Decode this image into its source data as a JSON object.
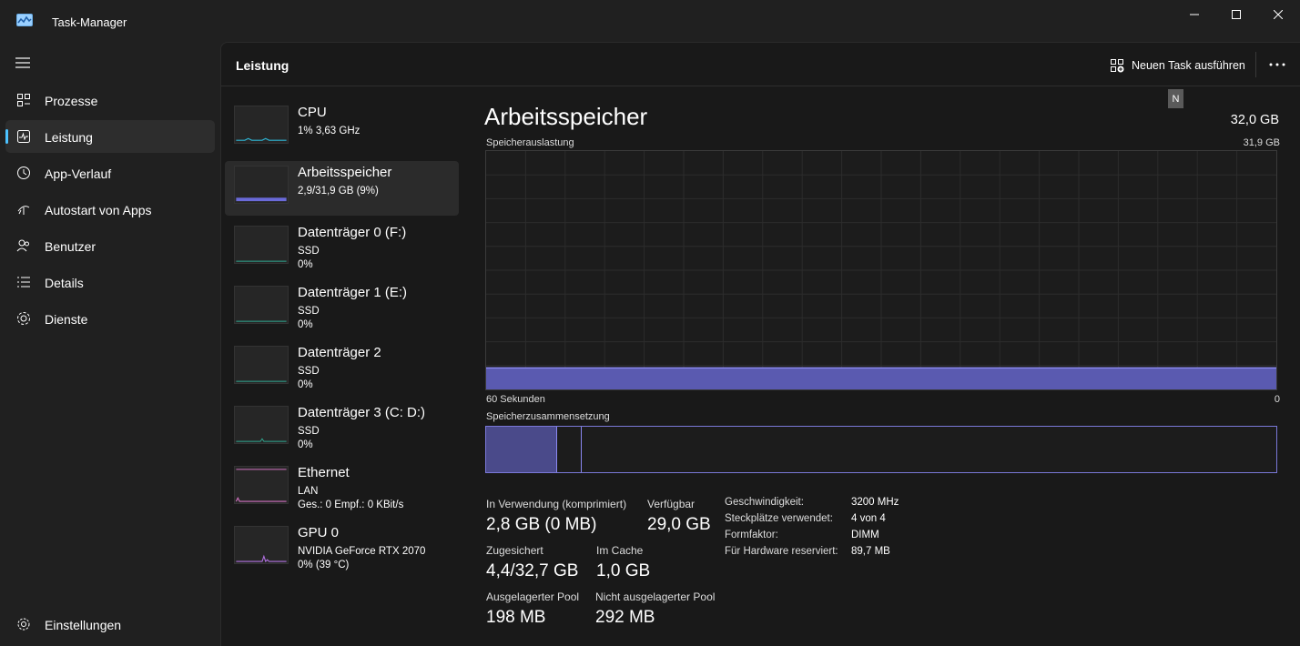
{
  "window": {
    "title": "Task-Manager"
  },
  "nav": {
    "items": [
      {
        "label": "Prozesse",
        "icon": "processes-icon"
      },
      {
        "label": "Leistung",
        "icon": "performance-icon",
        "active": true
      },
      {
        "label": "App-Verlauf",
        "icon": "app-history-icon"
      },
      {
        "label": "Autostart von Apps",
        "icon": "startup-apps-icon"
      },
      {
        "label": "Benutzer",
        "icon": "users-icon"
      },
      {
        "label": "Details",
        "icon": "details-icon"
      },
      {
        "label": "Dienste",
        "icon": "services-icon"
      }
    ],
    "settings": {
      "label": "Einstellungen",
      "icon": "settings-icon"
    }
  },
  "header": {
    "title": "Leistung",
    "new_task_label": "Neuen Task ausführen",
    "more_label": "...",
    "tooltip_letter": "N"
  },
  "resources": [
    {
      "title": "CPU",
      "line1": "1%  3,63 GHz",
      "line2": "",
      "line3": ""
    },
    {
      "title": "Arbeitsspeicher",
      "line1": "2,9/31,9 GB (9%)",
      "line2": "",
      "line3": ""
    },
    {
      "title": "Datenträger 0 (F:)",
      "line1": "SSD",
      "line2": "0%",
      "line3": ""
    },
    {
      "title": "Datenträger 1 (E:)",
      "line1": "SSD",
      "line2": "0%",
      "line3": ""
    },
    {
      "title": "Datenträger 2",
      "line1": "SSD",
      "line2": "0%",
      "line3": ""
    },
    {
      "title": "Datenträger 3 (C: D:)",
      "line1": "SSD",
      "line2": "0%",
      "line3": ""
    },
    {
      "title": "Ethernet",
      "line1": "LAN",
      "line2": "Ges.: 0 Empf.: 0 KBit/s",
      "line3": ""
    },
    {
      "title": "GPU 0",
      "line1": "NVIDIA GeForce RTX 2070",
      "line2": "0%  (39 °C)",
      "line3": ""
    }
  ],
  "detail": {
    "title": "Arbeitsspeicher",
    "total": "32,0 GB",
    "usage_label": "Speicherauslastung",
    "usage_max": "31,9 GB",
    "axis_left": "60 Sekunden",
    "axis_right": "0",
    "composition_label": "Speicherzusammensetzung",
    "usage_fraction": 0.09,
    "colors": {
      "fill": "#5a5ab0",
      "line": "#8a88f0",
      "grid": "#2c2c2c"
    }
  },
  "stats": {
    "in_use_label": "In Verwendung (komprimiert)",
    "in_use_value": "2,8 GB (0 MB)",
    "available_label": "Verfügbar",
    "available_value": "29,0 GB",
    "committed_label": "Zugesichert",
    "committed_value": "4,4/32,7 GB",
    "cached_label": "Im Cache",
    "cached_value": "1,0 GB",
    "paged_label": "Ausgelagerter Pool",
    "paged_value": "198 MB",
    "nonpaged_label": "Nicht ausgelagerter Pool",
    "nonpaged_value": "292 MB"
  },
  "specs": [
    {
      "key": "Geschwindigkeit:",
      "value": "3200 MHz"
    },
    {
      "key": "Steckplätze verwendet:",
      "value": "4 von 4"
    },
    {
      "key": "Formfaktor:",
      "value": "DIMM"
    },
    {
      "key": "Für Hardware reserviert:",
      "value": "89,7 MB"
    }
  ]
}
